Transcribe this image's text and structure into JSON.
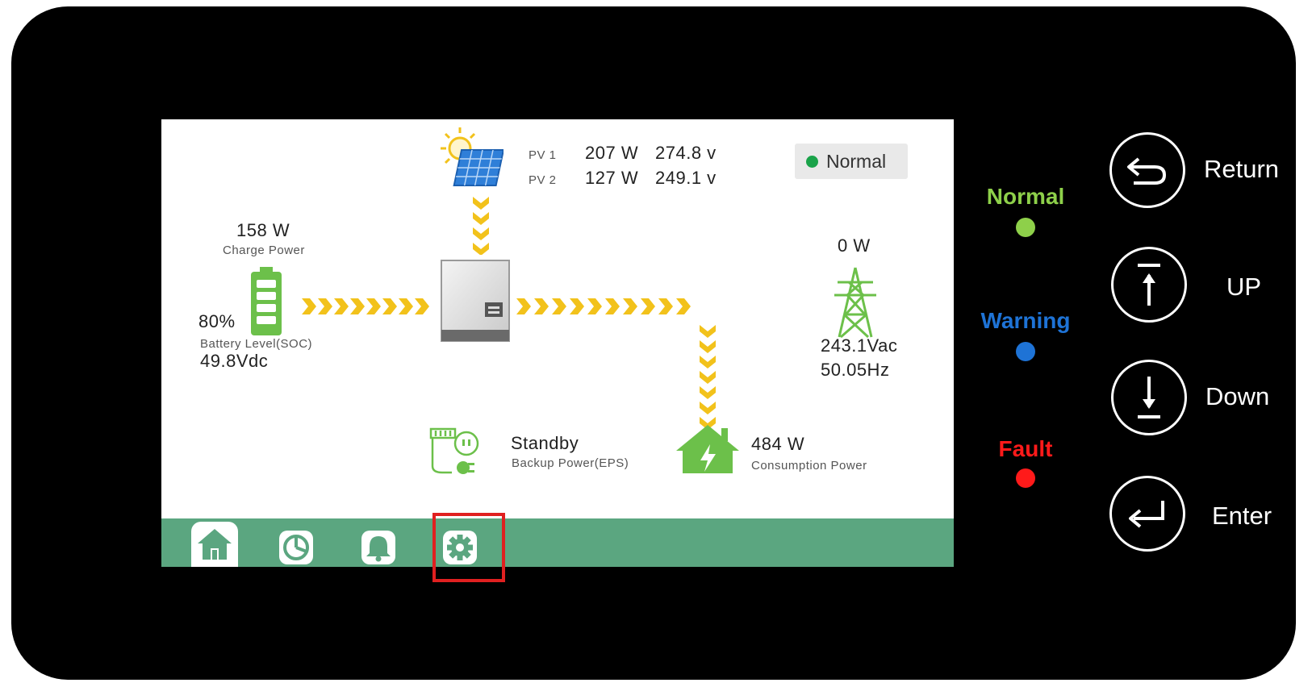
{
  "pv": {
    "pv1_label": "PV 1",
    "pv1_power": "207 W",
    "pv1_voltage": "274.8 v",
    "pv2_label": "PV 2",
    "pv2_power": "127 W",
    "pv2_voltage": "249.1 v"
  },
  "status": {
    "label": "Normal",
    "dot_color": "#1aa34a"
  },
  "battery": {
    "charge_power": "158 W",
    "charge_power_label": "Charge Power",
    "soc": "80%",
    "soc_label": "Battery  Level(SOC)",
    "voltage": "49.8Vdc",
    "icon": "battery-icon"
  },
  "grid": {
    "power": "0 W",
    "voltage": "243.1Vac",
    "frequency": "50.05Hz",
    "icon": "power-tower-icon"
  },
  "eps": {
    "status": "Standby",
    "label": "Backup Power(EPS)",
    "icon": "eps-plug-icon"
  },
  "load": {
    "power": "484 W",
    "label": "Consumption Power",
    "icon": "house-icon"
  },
  "nav": [
    {
      "name": "home",
      "icon": "home-icon"
    },
    {
      "name": "statistics",
      "icon": "pie-chart-icon"
    },
    {
      "name": "alarms",
      "icon": "bell-icon"
    },
    {
      "name": "settings",
      "icon": "gear-icon"
    }
  ],
  "leds": {
    "normal": {
      "label": "Normal",
      "color": "#8ed04a"
    },
    "warning": {
      "label": "Warning",
      "color": "#1e73d6"
    },
    "fault": {
      "label": "Fault",
      "color": "#ff1a1a"
    }
  },
  "buttons": {
    "return": "Return",
    "up": "UP",
    "down": "Down",
    "enter": "Enter"
  },
  "colors": {
    "accent_green": "#5ba680",
    "flow_arrow": "#f2c21b",
    "icon_green": "#6cc04a"
  }
}
